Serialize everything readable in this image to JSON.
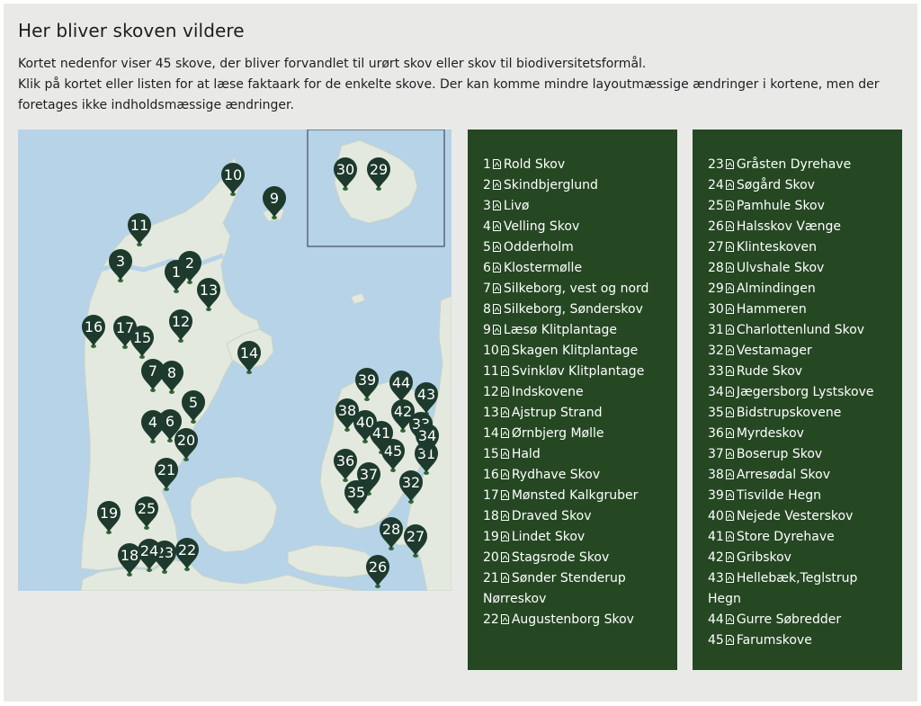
{
  "page": {
    "title": "Her bliver skoven vildere",
    "intro_line_1": "Kortet nedenfor viser 45 skove, der bliver forvandlet til urørt skov eller skov til biodiversitetsformål.",
    "intro_line_2": "Klik på kortet eller listen for at læse faktaark for de enkelte skove. Der kan komme mindre layoutmæssige ændringer i kortene, men der foretages ikke indholdsmæssige ændringer."
  },
  "colors": {
    "panel_bg": "#e9eae7",
    "list_bg": "#254823",
    "pin": "#1d3a2d",
    "sea": "#b6d3e8",
    "land": "#e3e9de",
    "forest": "#2f6b30"
  },
  "icons": {
    "document": "pdf-icon",
    "marker": "map-pin-icon"
  },
  "map": {
    "inset_labels": [
      "30",
      "29"
    ],
    "markers": [
      "1",
      "2",
      "3",
      "4",
      "5",
      "6",
      "7",
      "8",
      "9",
      "10",
      "11",
      "12",
      "13",
      "14",
      "15",
      "16",
      "17",
      "18",
      "19",
      "20",
      "21",
      "22",
      "23",
      "24",
      "25",
      "26",
      "27",
      "28",
      "29",
      "30",
      "31",
      "32",
      "33",
      "34",
      "35",
      "36",
      "37",
      "38",
      "39",
      "40",
      "41",
      "42",
      "43",
      "44",
      "45"
    ]
  },
  "forests": [
    {
      "num": "1",
      "name": "Rold Skov"
    },
    {
      "num": "2",
      "name": "Skindbjerglund"
    },
    {
      "num": "3",
      "name": "Livø"
    },
    {
      "num": "4",
      "name": "Velling Skov"
    },
    {
      "num": "5",
      "name": "Odderholm"
    },
    {
      "num": "6",
      "name": "Klostermølle"
    },
    {
      "num": "7",
      "name": "Silkeborg, vest og nord"
    },
    {
      "num": "8",
      "name": "Silkeborg, Sønderskov"
    },
    {
      "num": "9",
      "name": "Læsø Klitplantage"
    },
    {
      "num": "10",
      "name": "Skagen Klitplantage"
    },
    {
      "num": "11",
      "name": "Svinkløv Klitplantage"
    },
    {
      "num": "12",
      "name": "Indskovene"
    },
    {
      "num": "13",
      "name": "Ajstrup Strand"
    },
    {
      "num": "14",
      "name": "Ørnbjerg Mølle"
    },
    {
      "num": "15",
      "name": "Hald"
    },
    {
      "num": "16",
      "name": "Rydhave Skov"
    },
    {
      "num": "17",
      "name": "Mønsted Kalkgruber"
    },
    {
      "num": "18",
      "name": "Draved Skov"
    },
    {
      "num": "19",
      "name": "Lindet Skov"
    },
    {
      "num": "20",
      "name": "Stagsrode Skov"
    },
    {
      "num": "21",
      "name": "Sønder Stenderup Nørreskov"
    },
    {
      "num": "22",
      "name": "Augustenborg Skov"
    },
    {
      "num": "23",
      "name": "Gråsten Dyrehave"
    },
    {
      "num": "24",
      "name": "Søgård Skov"
    },
    {
      "num": "25",
      "name": "Pamhule Skov"
    },
    {
      "num": "26",
      "name": "Halsskov Vænge"
    },
    {
      "num": "27",
      "name": "Klinteskoven"
    },
    {
      "num": "28",
      "name": "Ulvshale Skov"
    },
    {
      "num": "29",
      "name": "Almindingen"
    },
    {
      "num": "30",
      "name": "Hammeren"
    },
    {
      "num": "31",
      "name": "Charlottenlund Skov"
    },
    {
      "num": "32",
      "name": "Vestamager"
    },
    {
      "num": "33",
      "name": "Rude Skov"
    },
    {
      "num": "34",
      "name": "Jægersborg Lystskove"
    },
    {
      "num": "35",
      "name": "Bidstrupskovene"
    },
    {
      "num": "36",
      "name": "Myrdeskov"
    },
    {
      "num": "37",
      "name": "Boserup Skov"
    },
    {
      "num": "38",
      "name": "Arresødal Skov"
    },
    {
      "num": "39",
      "name": "Tisvilde Hegn"
    },
    {
      "num": "40",
      "name": "Nejede Vesterskov"
    },
    {
      "num": "41",
      "name": "Store Dyrehave"
    },
    {
      "num": "42",
      "name": "Gribskov"
    },
    {
      "num": "43",
      "name": "Hellebæk,Teglstrup Hegn"
    },
    {
      "num": "44",
      "name": "Gurre Søbredder"
    },
    {
      "num": "45",
      "name": "Farumskove"
    }
  ]
}
